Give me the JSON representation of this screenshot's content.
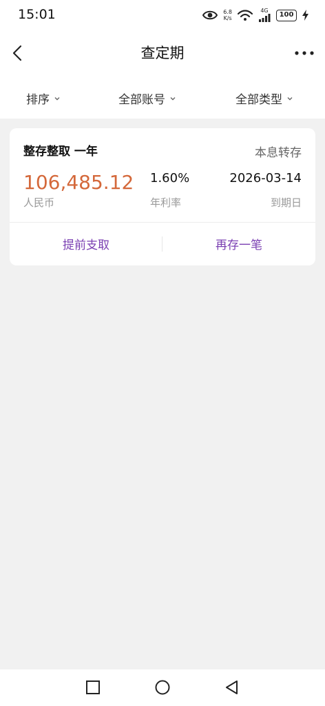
{
  "status_bar": {
    "time": "15:01",
    "net_speed_value": "6.8",
    "net_speed_unit": "K/s",
    "network_type": "4G",
    "battery": "100"
  },
  "header": {
    "title": "查定期",
    "back_icon": "chevron-left-icon",
    "more_icon": "more-horizontal-icon"
  },
  "filters": [
    {
      "label": "排序"
    },
    {
      "label": "全部账号"
    },
    {
      "label": "全部类型"
    }
  ],
  "deposit": {
    "product": "整存整取 一年",
    "rollover": "本息转存",
    "amount": "106,485.12",
    "currency": "人民币",
    "rate": "1.60%",
    "rate_label": "年利率",
    "maturity_date": "2026-03-14",
    "maturity_label": "到期日",
    "actions": [
      "提前支取",
      "再存一笔"
    ]
  },
  "colors": {
    "amount": "#d4683a",
    "action": "#7a3fb2",
    "background": "#f1f1f1"
  },
  "nav_bar": [
    "square-icon",
    "circle-icon",
    "triangle-back-icon"
  ]
}
